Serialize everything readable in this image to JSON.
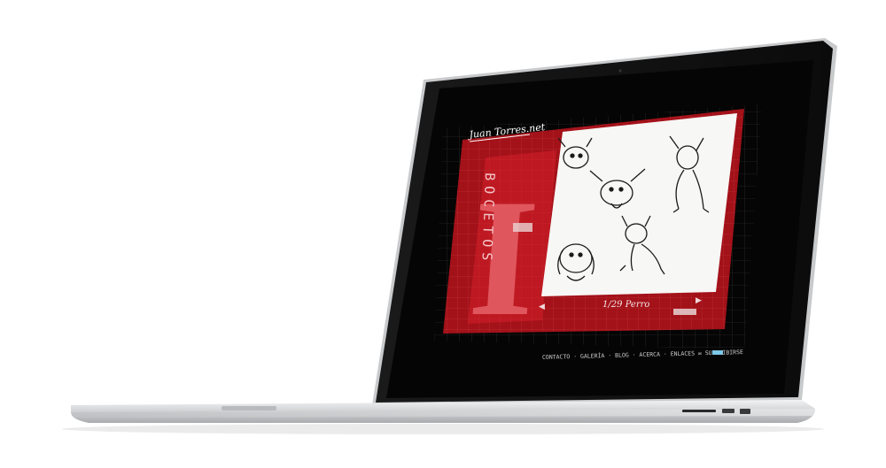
{
  "site": {
    "logo_text": "Juan Torres.net",
    "section_title": "BOCETOS",
    "section_letter": "I",
    "pager_text": "1/29 Perro",
    "prev_label": "◀",
    "next_label": "▶",
    "footer_links": "CONTACTO · GALERÍA · BLOG · ACERCA · ENLACES ✉ SUSCRIBIRSE"
  },
  "colors": {
    "screen_bg": "#050505",
    "panel_red": "#b0121b",
    "panel_dark_red": "#7a0b10",
    "grid": "#3a3a3a",
    "laptop_silver": "#d9dadc"
  }
}
